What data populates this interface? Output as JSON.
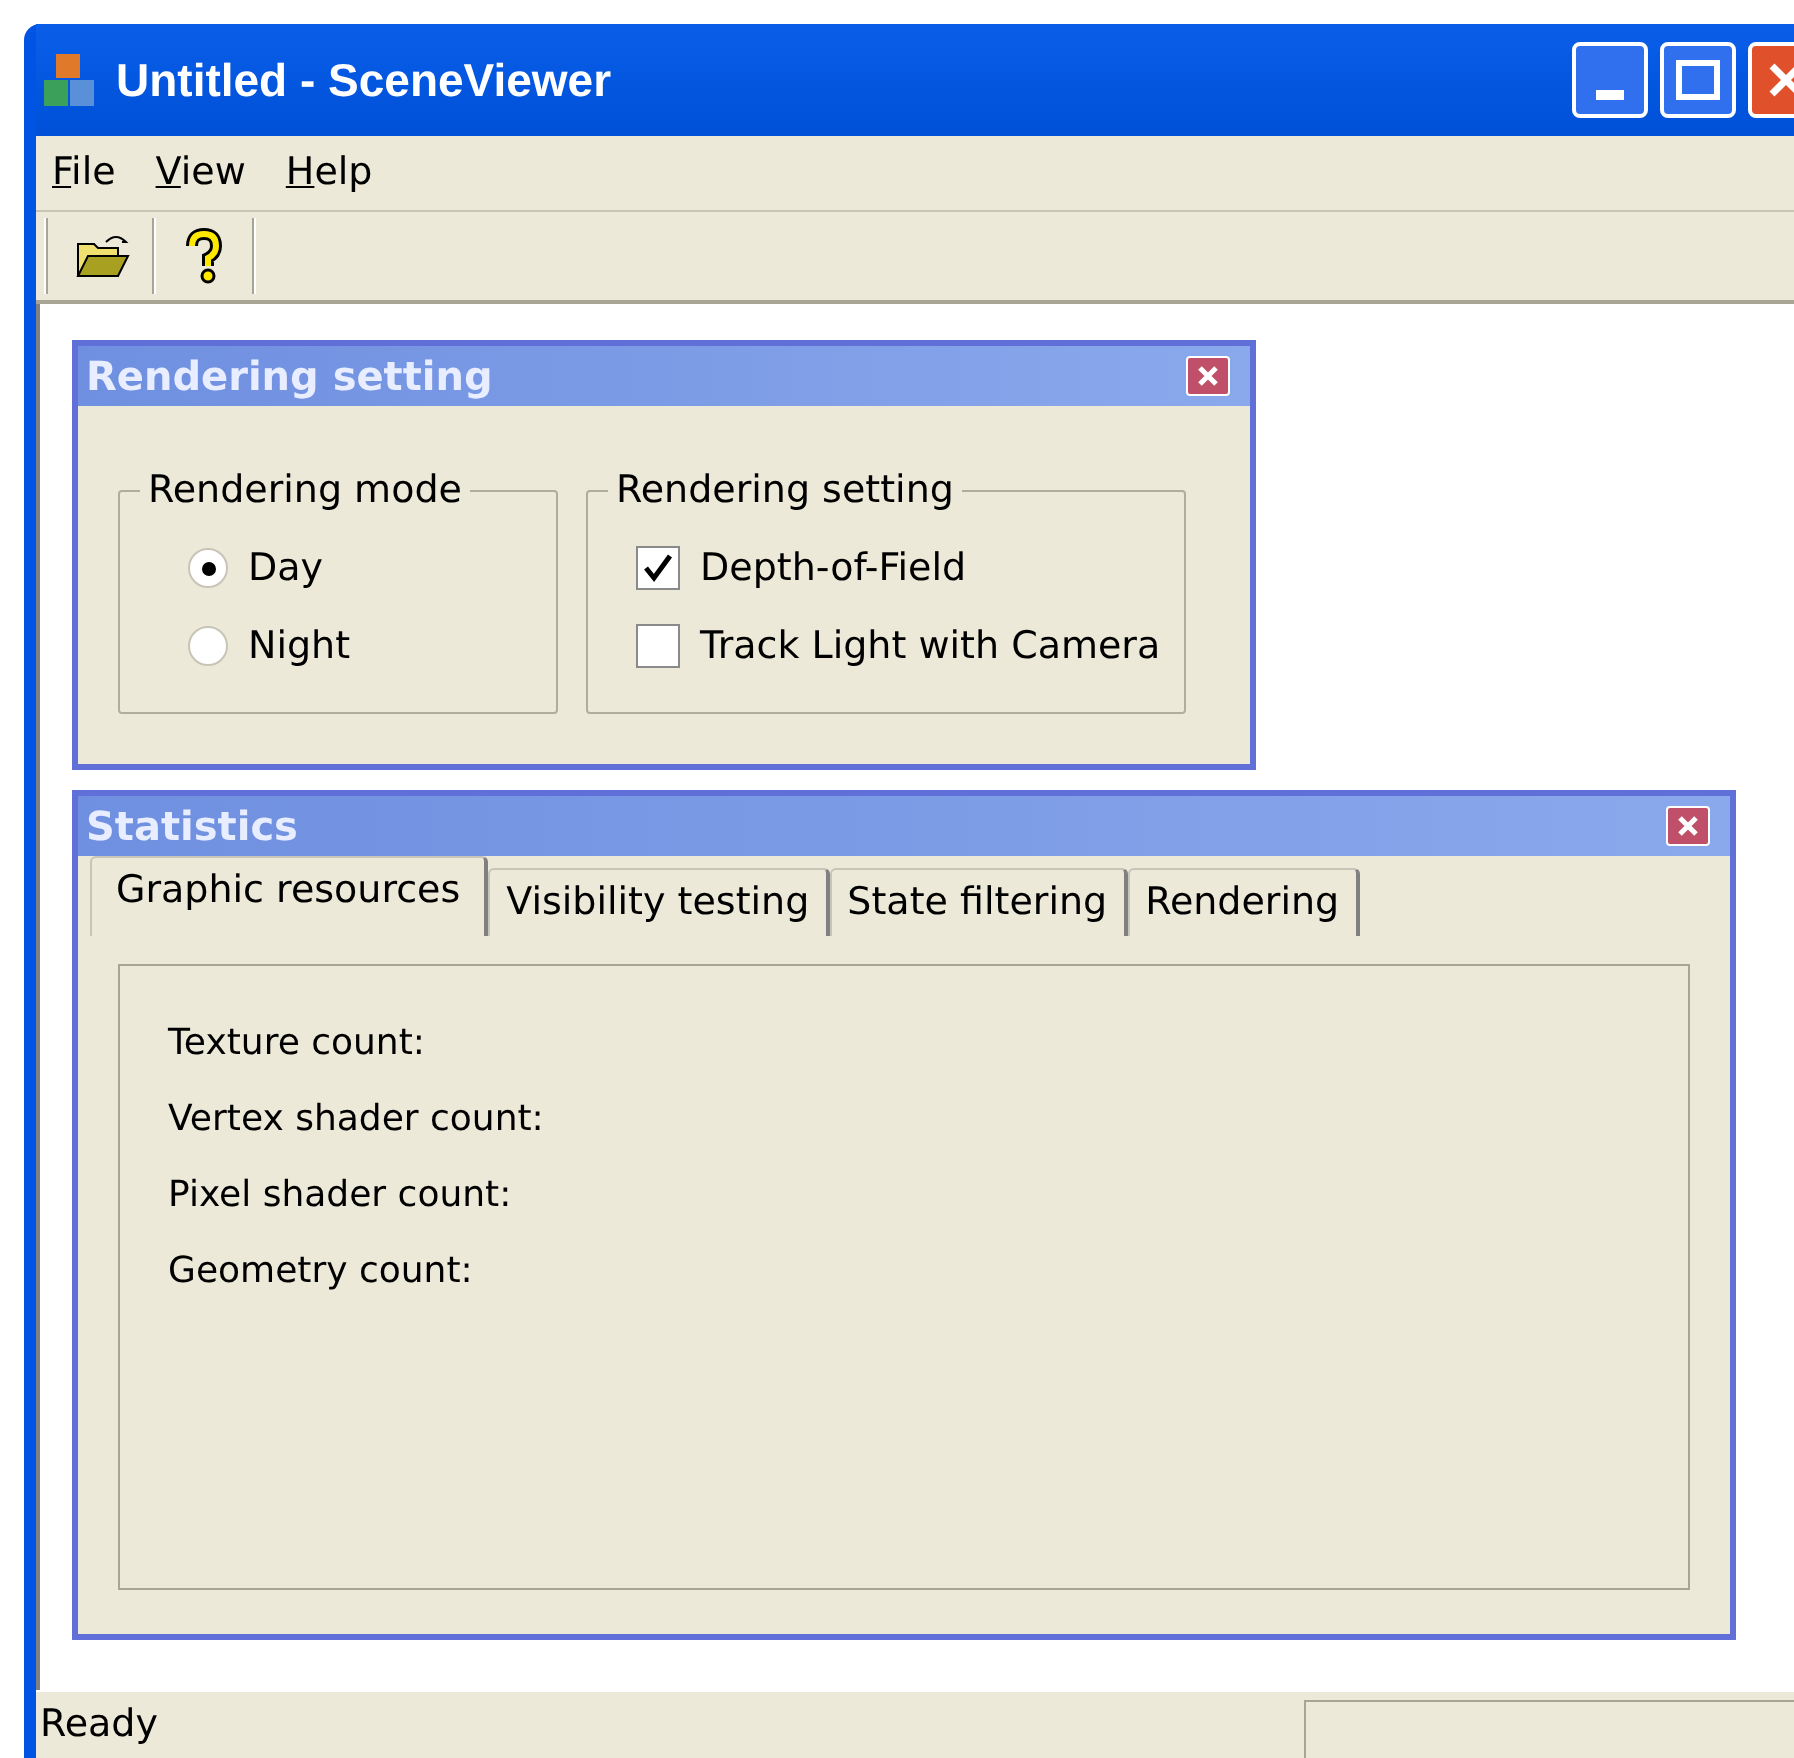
{
  "window": {
    "title": "Untitled - SceneViewer"
  },
  "menu": [
    {
      "label": "File"
    },
    {
      "label": "View"
    },
    {
      "label": "Help"
    }
  ],
  "toolbar": [
    {
      "kind": "open"
    },
    {
      "kind": "help"
    }
  ],
  "rendering_panel": {
    "title": "Rendering setting",
    "mode_group": {
      "title": "Rendering mode",
      "options": [
        {
          "label": "Day",
          "selected": true
        },
        {
          "label": "Night",
          "selected": false
        }
      ]
    },
    "setting_group": {
      "title": "Rendering setting",
      "options": [
        {
          "label": "Depth-of-Field",
          "checked": true
        },
        {
          "label": "Track Light with Camera",
          "checked": false
        }
      ]
    }
  },
  "statistics_panel": {
    "title": "Statistics",
    "tabs": [
      {
        "label": "Graphic resources",
        "selected": true
      },
      {
        "label": "Visibility testing",
        "selected": false
      },
      {
        "label": "State filtering",
        "selected": false
      },
      {
        "label": "Rendering",
        "selected": false
      }
    ],
    "fields": [
      "Texture count:",
      "Vertex shader count:",
      "Pixel shader count:",
      "Geometry count:"
    ]
  },
  "status_bar": {
    "text": "Ready"
  }
}
